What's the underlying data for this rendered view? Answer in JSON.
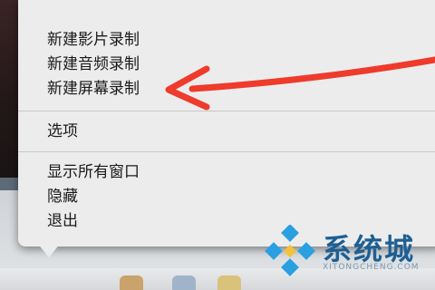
{
  "menu": {
    "group1": [
      "新建影片录制",
      "新建音频录制",
      "新建屏幕录制"
    ],
    "group2": [
      "选项"
    ],
    "group3": [
      "显示所有窗口",
      "隐藏",
      "退出"
    ]
  },
  "annotation": {
    "arrow_color": "#ee3b2b",
    "icon": "red-arrow-icon"
  },
  "watermark": {
    "title": "系统城",
    "subtitle": "XITONGCHENG.COM",
    "logo_color": "#2aa0e0"
  }
}
